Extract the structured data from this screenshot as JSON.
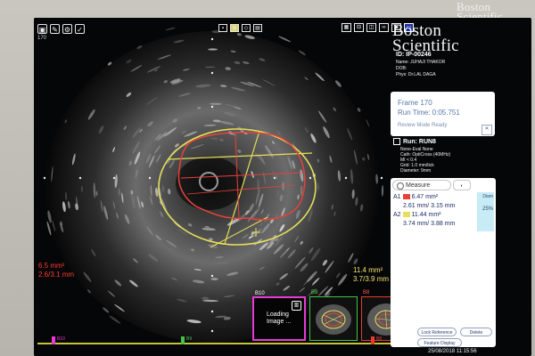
{
  "bezel": {
    "logo": "Boston Scientific"
  },
  "header": {
    "subframe": "170"
  },
  "brand": {
    "name": "Boston Scientific"
  },
  "patient": {
    "id": "ID: IP-00246",
    "name": "Name: JUHAJI THAKOR",
    "dob": "DOB:",
    "phys": "Phys:   Dr.LAL DAGA"
  },
  "frame": {
    "frame_label": "Frame 170",
    "run_time": "Run Time: 0:05.751",
    "status": "Review Mode Ready"
  },
  "run": {
    "title": "Run: RUN8",
    "subtitle": "None-Eval None",
    "cath": "Cath: OptiCross (40MHz)",
    "mi": "MI <   0.4",
    "grid": "Grid:    1.0 mm/tick",
    "diameter": "Diameter:    9mm"
  },
  "measure": {
    "tab_label": "Measure",
    "a1_label": "A1",
    "a1_area": "6.47 mm²",
    "a1_dims": "2.61 mm/ 3.15 mm",
    "a2_label": "A2",
    "a2_area": "11.44 mm²",
    "a2_dims": "3.74 mm/ 3.88 mm",
    "diam_label": "Diam",
    "pct": "25%",
    "btn_lock": "Lock Reference",
    "btn_delete": "Delete",
    "btn_feature": "Feature Display"
  },
  "overlay": {
    "left_area": "6.5 mm²",
    "left_dims": "2.6/3.1 mm",
    "right_area": "11.4 mm²",
    "right_dims": "3.7/3.9 mm"
  },
  "thumbs": {
    "b10_label": "B10",
    "b10_loading": "Loading Image ...",
    "b9_label": "B9",
    "b8_label": "B8"
  },
  "timeline": {
    "b10": "B10",
    "b9": "B9",
    "b8": "B8"
  },
  "datetime": "25/08/2018 11:15:56",
  "colors": {
    "lumen": "#e9413a",
    "vessel": "#e6e05a",
    "accent_blue": "#5678ad",
    "thumb_b10": "#e73bd5",
    "thumb_b9": "#46c24a",
    "thumb_b8": "#e83b2e"
  }
}
